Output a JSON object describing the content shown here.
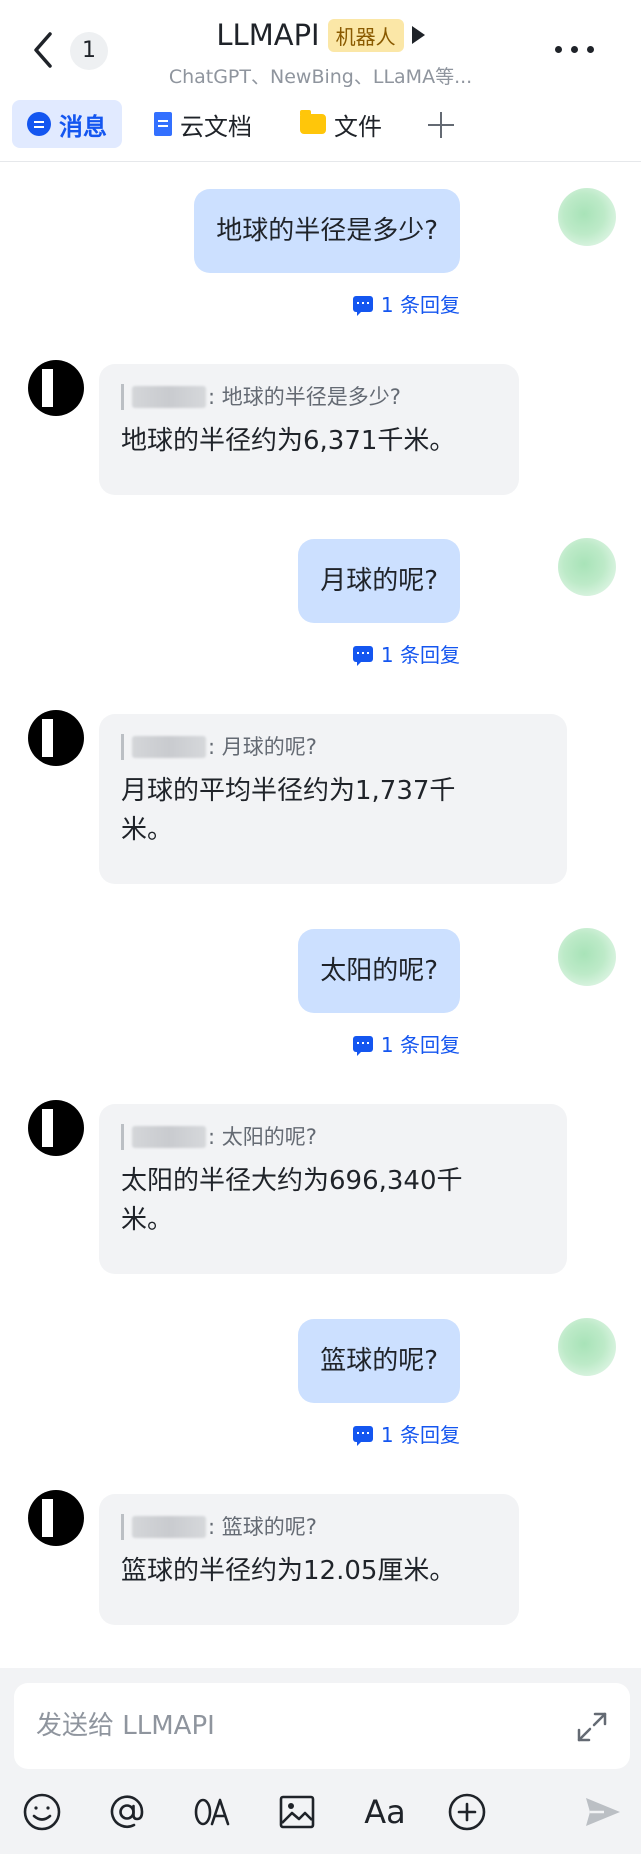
{
  "header": {
    "back_icon": "chevron-left-icon",
    "unread_count": "1",
    "title": "LLMAPI",
    "badge": "机器人",
    "subtitle": "ChatGPT、NewBing、LLaMA等...",
    "more_icon": "more-icon"
  },
  "tabs": [
    {
      "label": "消息",
      "icon": "chat-icon",
      "active": true
    },
    {
      "label": "云文档",
      "icon": "doc-icon",
      "active": false
    },
    {
      "label": "文件",
      "icon": "folder-icon",
      "active": false
    }
  ],
  "messages": [
    {
      "from": "me",
      "text": "地球的半径是多少?",
      "reply_label": "1 条回复"
    },
    {
      "from": "bot",
      "quote": ": 地球的半径是多少?",
      "text": "地球的半径约为6,371千米。"
    },
    {
      "from": "me",
      "text": "月球的呢?",
      "reply_label": "1 条回复"
    },
    {
      "from": "bot",
      "quote": ": 月球的呢?",
      "text_lines": [
        "月球的平均半径约为1,737千",
        "米。"
      ]
    },
    {
      "from": "me",
      "text": "太阳的呢?",
      "reply_label": "1 条回复"
    },
    {
      "from": "bot",
      "quote": ": 太阳的呢?",
      "text_lines": [
        "太阳的半径大约为696,340千",
        "米。"
      ]
    },
    {
      "from": "me",
      "text": "篮球的呢?",
      "reply_label": "1 条回复"
    },
    {
      "from": "bot",
      "quote": ": 篮球的呢?",
      "text": "篮球的半径约为12.05厘米。"
    }
  ],
  "composer": {
    "placeholder": "发送给 LLMAPI",
    "tools": [
      "emoji-icon",
      "mention-icon",
      "translate-icon",
      "image-icon",
      "text-format-icon",
      "add-icon",
      "send-icon"
    ],
    "format_label": "Aa"
  },
  "colors": {
    "accent": "#1456f0",
    "my_bubble": "#cce0ff",
    "bot_bubble": "#f2f3f5",
    "badge_bg": "#fbe7a7"
  }
}
